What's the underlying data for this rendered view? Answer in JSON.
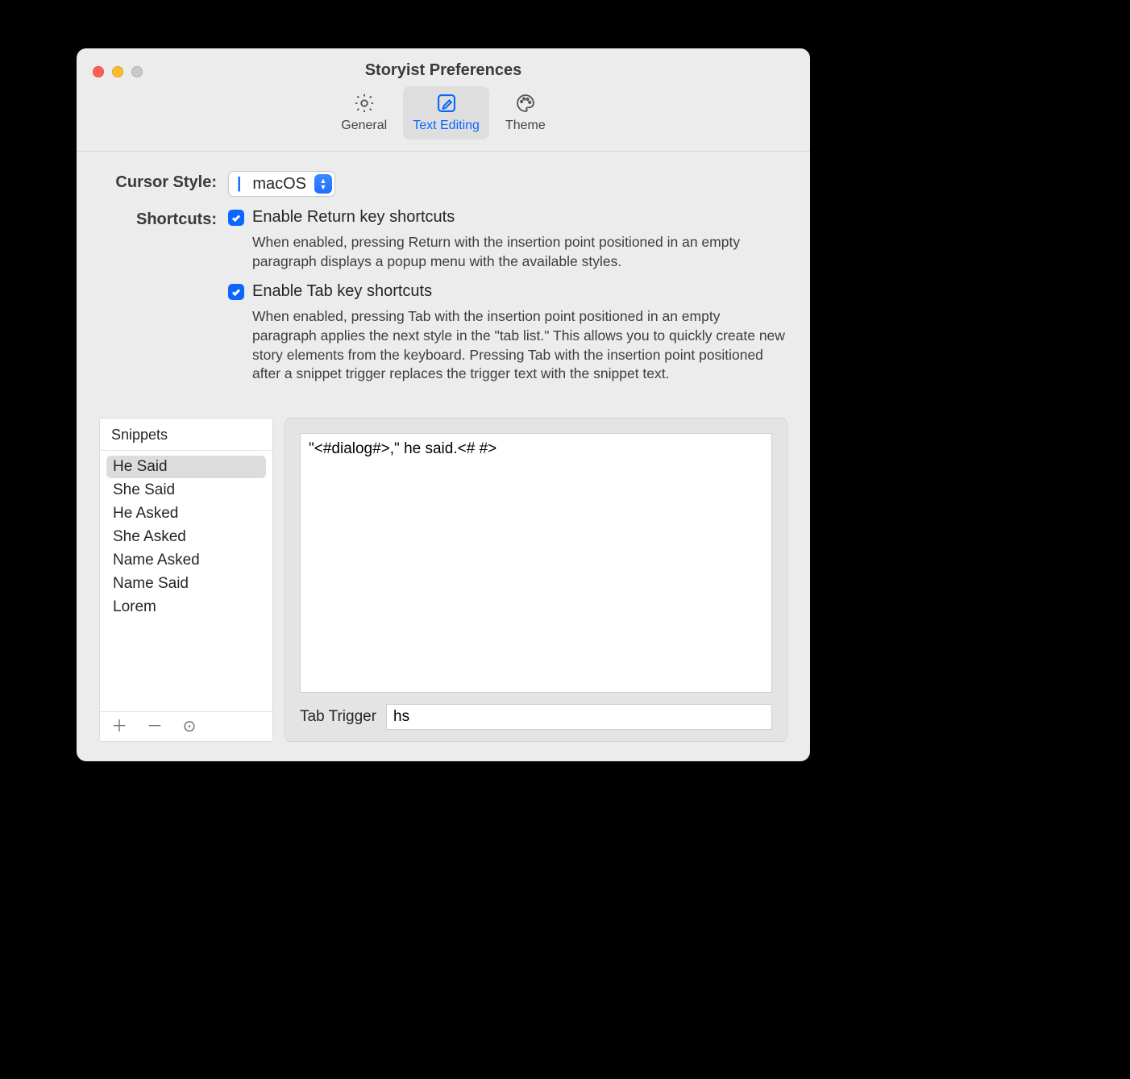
{
  "window": {
    "title": "Storyist Preferences"
  },
  "toolbar": {
    "tabs": [
      {
        "label": "General",
        "icon": "gear-icon",
        "selected": false
      },
      {
        "label": "Text Editing",
        "icon": "compose-icon",
        "selected": true
      },
      {
        "label": "Theme",
        "icon": "palette-icon",
        "selected": false
      }
    ]
  },
  "form": {
    "cursor_style": {
      "label": "Cursor Style:",
      "value": "macOS"
    },
    "shortcuts_label": "Shortcuts:",
    "return_shortcut": {
      "checked": true,
      "label": "Enable Return key shortcuts",
      "desc": "When enabled, pressing Return with the insertion point positioned in an empty paragraph displays a popup menu with the available styles."
    },
    "tab_shortcut": {
      "checked": true,
      "label": "Enable Tab key shortcuts",
      "desc": "When enabled, pressing Tab with the insertion point positioned in an empty paragraph applies the next style in the \"tab list.\" This allows you to quickly create new story elements from the keyboard. Pressing Tab with the insertion point positioned after a snippet trigger replaces the trigger text with the snippet text."
    }
  },
  "snippets": {
    "header": "Snippets",
    "items": [
      {
        "name": "He Said",
        "selected": true
      },
      {
        "name": "She Said",
        "selected": false
      },
      {
        "name": "He Asked",
        "selected": false
      },
      {
        "name": "She Asked",
        "selected": false
      },
      {
        "name": "Name Asked",
        "selected": false
      },
      {
        "name": "Name Said",
        "selected": false
      },
      {
        "name": "Lorem",
        "selected": false
      }
    ]
  },
  "editor": {
    "body": "\"<#dialog#>,\" he said.<# #>",
    "trigger_label": "Tab Trigger",
    "trigger_value": "hs"
  }
}
